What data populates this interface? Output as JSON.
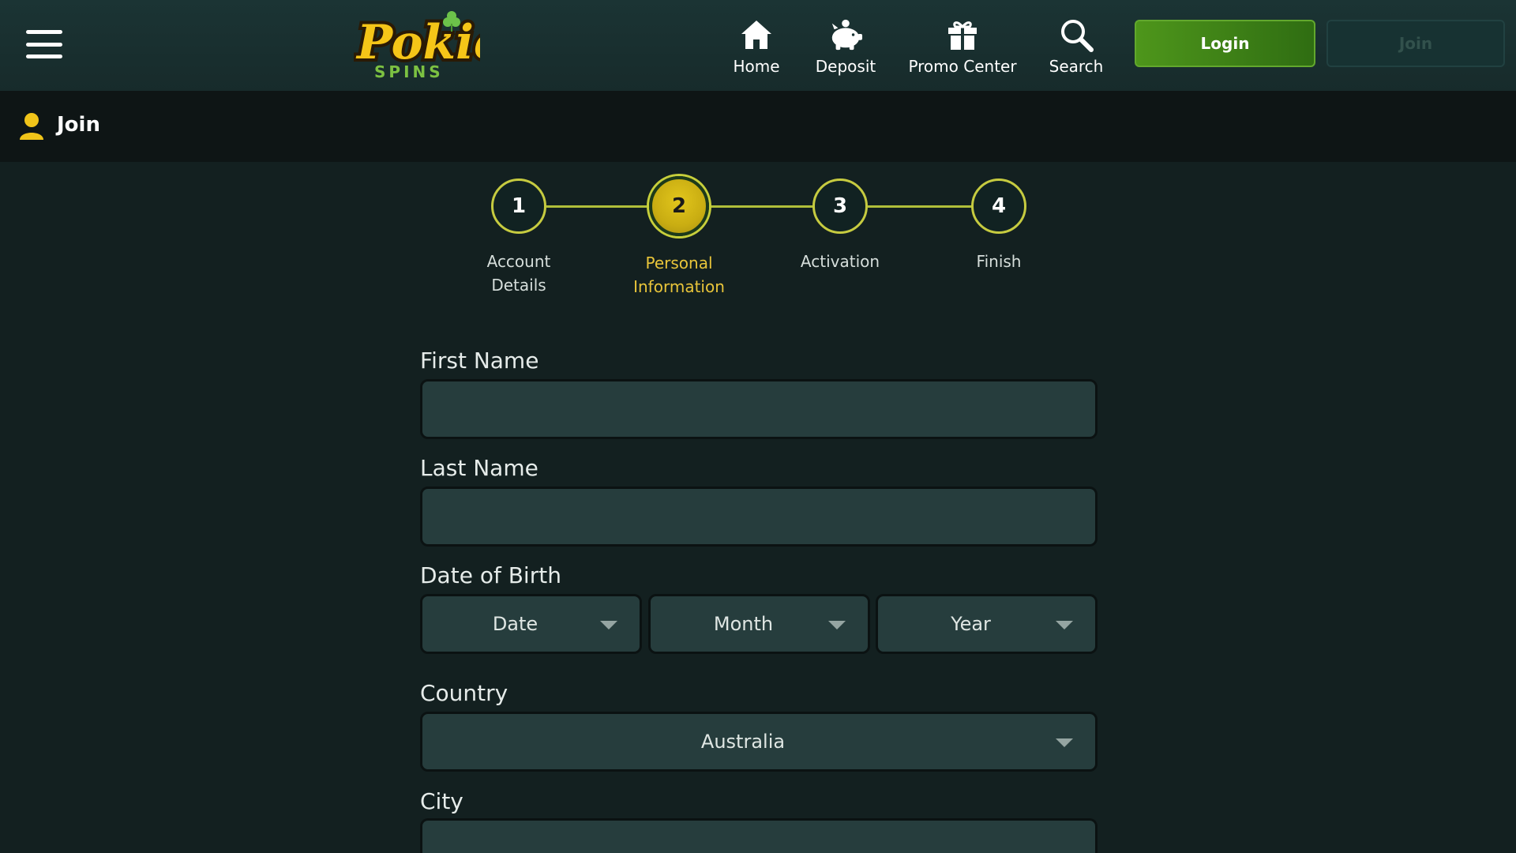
{
  "header": {
    "logo": {
      "word": "Pokie",
      "sub": "SPINS"
    },
    "nav": [
      {
        "label": "Home",
        "icon": "home-icon"
      },
      {
        "label": "Deposit",
        "icon": "piggy-bank-icon"
      },
      {
        "label": "Promo Center",
        "icon": "gift-icon"
      },
      {
        "label": "Search",
        "icon": "search-icon"
      }
    ],
    "login_label": "Login",
    "join_label": "Join"
  },
  "page": {
    "title": "Join",
    "title_icon": "user-icon"
  },
  "stepper": {
    "active_step": 2,
    "steps": [
      {
        "number": "1",
        "label_line1": "Account",
        "label_line2": "Details"
      },
      {
        "number": "2",
        "label_line1": "Personal",
        "label_line2": "Information"
      },
      {
        "number": "3",
        "label_line1": "Activation",
        "label_line2": ""
      },
      {
        "number": "4",
        "label_line1": "Finish",
        "label_line2": ""
      }
    ]
  },
  "form": {
    "first_name": {
      "label": "First Name",
      "value": ""
    },
    "last_name": {
      "label": "Last Name",
      "value": ""
    },
    "dob": {
      "label": "Date of Birth",
      "date_selected": "Date",
      "month_selected": "Month",
      "year_selected": "Year"
    },
    "country": {
      "label": "Country",
      "selected": "Australia"
    },
    "city": {
      "label": "City",
      "value": ""
    }
  },
  "colors": {
    "header_bg": "#1b3434",
    "page_bg": "#132020",
    "titlebar_bg": "#0e1515",
    "accent_green": "#4e961b",
    "accent_yellow": "#e2c61c",
    "active_step_label": "#e9c53a",
    "input_bg": "#263d3d"
  }
}
